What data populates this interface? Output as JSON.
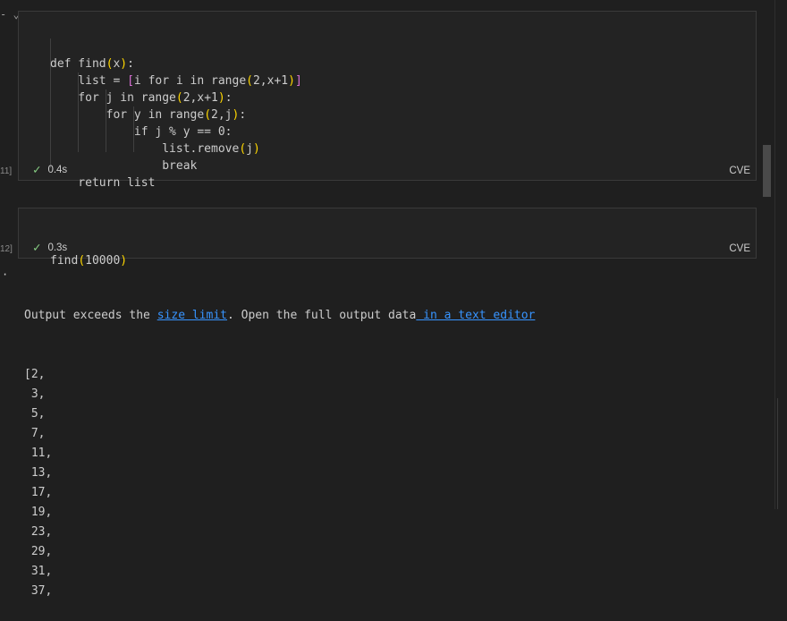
{
  "gutter": {
    "cell1_exec": "11]",
    "cell2_exec": "12]",
    "output_bullet": "·"
  },
  "cell1": {
    "code_lines": [
      "def find(x):",
      "    list = [i for i in range(2,x+1)]",
      "    for j in range(2,x+1):",
      "        for y in range(2,j):",
      "            if j % y == 0:",
      "                list.remove(j)",
      "                break",
      "    return list"
    ],
    "status_time": "0.4s",
    "language": "CVE"
  },
  "cell2": {
    "code_line": "find(10000)",
    "status_time": "0.3s",
    "language": "CVE"
  },
  "output": {
    "message_prefix": "Output exceeds the ",
    "link1": "size limit",
    "message_middle": ". Open the full output data",
    "link2": " in a text editor",
    "lines": [
      "[2,",
      " 3,",
      " 5,",
      " 7,",
      " 11,",
      " 13,",
      " 17,",
      " 19,",
      " 23,",
      " 29,",
      " 31,",
      " 37,"
    ]
  },
  "colors": {
    "check": "#89d185",
    "link": "#3794ff",
    "paren": "#ffd700",
    "bracket": "#da70d6"
  }
}
